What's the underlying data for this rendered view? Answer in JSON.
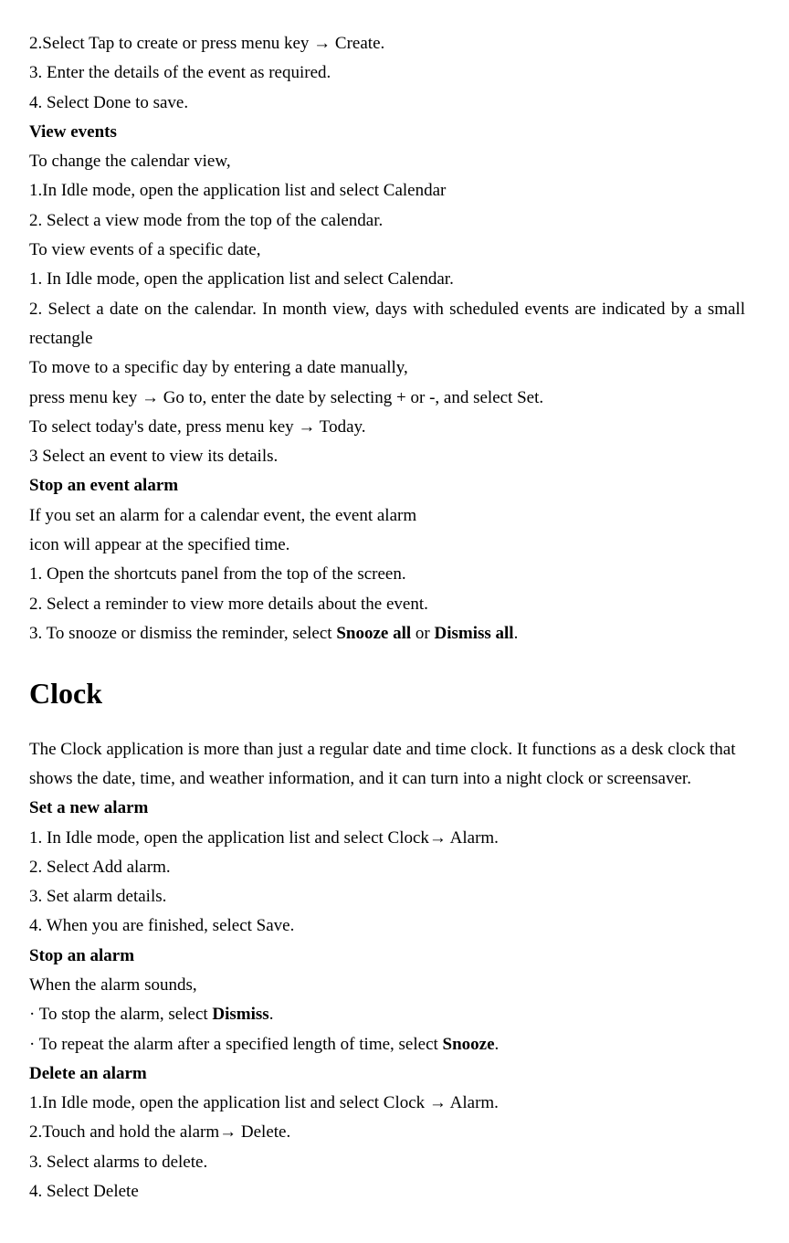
{
  "lines": {
    "l1": "2.Select Tap to create or press menu key  →  Create.",
    "l2": "3. Enter the details of the event as required.",
    "l3": "4. Select Done to save.",
    "l4": "View events",
    "l5": "To change the calendar view,",
    "l6": "1.In Idle mode, open the application list and select Calendar",
    "l7": "2. Select a view mode from the top of the calendar.",
    "l8": "To view events of a specific date,",
    "l9": "1. In Idle mode, open the application list and select Calendar.",
    "l10": "2. Select a date on the calendar. In month view, days with scheduled events are indicated by a small rectangle",
    "l11": "To move to a specific day by entering a date manually,",
    "l12": "press menu key  →  Go to, enter the date by selecting + or -, and select Set.",
    "l13": "To select today's date, press menu key  →  Today.",
    "l14": "3 Select an event to view its details.",
    "l15": "Stop an event alarm",
    "l16": "If you set an alarm for a calendar event, the event alarm",
    "l17": "icon will appear at the specified time.",
    "l18": "1. Open the shortcuts panel from the top of the screen.",
    "l19": "2. Select a reminder to view more details about the event.",
    "l20a": "3. To snooze or dismiss the reminder, select ",
    "l20b": "Snooze all",
    "l20c": " or ",
    "l20d": "Dismiss all",
    "l20e": ".",
    "h1": "Clock",
    "l21": "The Clock application is more than just a regular date and time clock. It functions as a desk clock that shows the date, time, and weather information, and it can turn into a night clock or screensaver.",
    "l22": "Set a new alarm",
    "l23": "1. In Idle mode, open the application list and select Clock→  Alarm.",
    "l24": "2. Select Add alarm.",
    "l25": "3. Set alarm details.",
    "l26": "4. When you are finished, select Save.",
    "l27": "Stop an alarm",
    "l28": "When the alarm sounds,",
    "l29a": "· To stop the alarm, select ",
    "l29b": "Dismiss",
    "l29c": ".",
    "l30a": "· To repeat the alarm after a specified length of time, select ",
    "l30b": "Snooze",
    "l30c": ".",
    "l31": "Delete an alarm",
    "l32": "1.In Idle mode, open the application list and select Clock  →  Alarm.",
    "l33": "2.Touch and hold the alarm→  Delete.",
    "l34": "3. Select alarms to delete.",
    "l35": "4. Select Delete"
  }
}
